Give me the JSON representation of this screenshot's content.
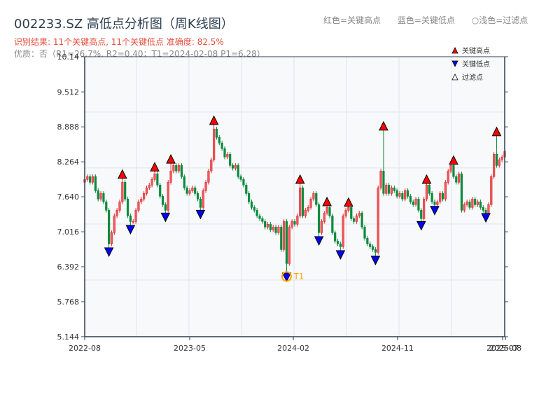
{
  "header": {
    "title": "002233.SZ 高低点分析图（周K线图）",
    "result": "识别结果: 11个关键高点, 11个关键低点  准确度: 82.5%",
    "quality": "优质：否（R1=26.7%, R2=0.40；T1=2024-02-08 P1=6.28）"
  },
  "top_legend": [
    "红色=关键高点",
    "蓝色=关键低点",
    "○浅色=过滤点"
  ],
  "colors": {
    "up": "#e02a2f",
    "down": "#0b8a3c",
    "key_high": "#ff0000",
    "key_low": "#0000ff",
    "t1": "#ffa500",
    "plot_bg": "#f7f9fb",
    "axis": "#2c3e50"
  },
  "chart_data": {
    "type": "candlestick",
    "title": "002233.SZ 高低点分析图（周K线图）",
    "ylim": [
      5.144,
      10.14
    ],
    "y_ticks": [
      "5.144",
      "5.768",
      "6.392",
      "7.016",
      "7.640",
      "8.264",
      "8.888",
      "9.512",
      "10.14"
    ],
    "x_ticks": [
      "2022-08",
      "2023-05",
      "2024-02",
      "2024-11",
      "2025-07",
      "2025-08"
    ],
    "grid": true,
    "legend_position": "top-right",
    "legend": [
      {
        "label": "关键高点",
        "marker": "triangle-up",
        "color": "#ff0000"
      },
      {
        "label": "关键低点",
        "marker": "triangle-down",
        "color": "#0000ff"
      },
      {
        "label": "过滤点",
        "marker": "triangle-up-hollow",
        "color": "#888888"
      }
    ],
    "close": [
      7.95,
      8.0,
      7.9,
      8.0,
      7.75,
      7.6,
      7.7,
      7.55,
      7.4,
      6.8,
      7.0,
      7.3,
      7.4,
      7.55,
      7.9,
      7.6,
      7.3,
      7.2,
      7.2,
      7.4,
      7.55,
      7.6,
      7.7,
      7.8,
      7.85,
      7.95,
      8.05,
      7.85,
      7.65,
      7.5,
      7.4,
      7.9,
      8.1,
      8.2,
      8.1,
      8.2,
      8.0,
      7.8,
      7.7,
      7.75,
      7.8,
      7.7,
      7.6,
      7.45,
      7.75,
      7.9,
      8.1,
      8.3,
      8.85,
      8.7,
      8.6,
      8.5,
      8.35,
      8.4,
      8.2,
      8.15,
      8.2,
      8.0,
      7.95,
      7.85,
      7.7,
      7.55,
      7.45,
      7.4,
      7.3,
      7.25,
      7.2,
      7.1,
      7.15,
      7.05,
      7.1,
      7.0,
      7.1,
      6.7,
      7.2,
      6.45,
      7.1,
      7.2,
      7.15,
      7.3,
      7.8,
      7.3,
      7.4,
      7.45,
      7.6,
      7.7,
      7.5,
      7.0,
      7.2,
      7.35,
      7.45,
      7.3,
      7.0,
      6.85,
      6.8,
      6.75,
      7.3,
      7.4,
      7.45,
      7.25,
      7.2,
      7.3,
      7.35,
      7.1,
      6.9,
      6.8,
      6.75,
      6.7,
      6.65,
      7.8,
      8.1,
      7.7,
      7.85,
      7.7,
      7.8,
      7.75,
      7.65,
      7.7,
      7.6,
      7.75,
      7.65,
      7.55,
      7.5,
      7.6,
      7.4,
      7.25,
      7.6,
      7.85,
      7.7,
      7.55,
      7.5,
      7.55,
      7.7,
      7.6,
      7.9,
      8.1,
      8.2,
      8.0,
      7.9,
      8.05,
      7.4,
      7.5,
      7.55,
      7.45,
      7.6,
      7.5,
      7.55,
      7.45,
      7.4,
      7.35,
      7.5,
      8.0,
      8.4,
      8.2,
      8.3,
      8.35,
      8.45
    ],
    "key_highs": [
      {
        "i": 14,
        "v": 7.97
      },
      {
        "i": 26,
        "v": 8.1
      },
      {
        "i": 32,
        "v": 8.24
      },
      {
        "i": 48,
        "v": 8.93
      },
      {
        "i": 80,
        "v": 7.88
      },
      {
        "i": 90,
        "v": 7.48
      },
      {
        "i": 98,
        "v": 7.47
      },
      {
        "i": 111,
        "v": 8.83
      },
      {
        "i": 127,
        "v": 7.88
      },
      {
        "i": 137,
        "v": 8.22
      },
      {
        "i": 153,
        "v": 8.73
      }
    ],
    "key_lows": [
      {
        "i": 9,
        "v": 6.73
      },
      {
        "i": 17,
        "v": 7.13
      },
      {
        "i": 30,
        "v": 7.35
      },
      {
        "i": 43,
        "v": 7.4
      },
      {
        "i": 75,
        "v": 6.28
      },
      {
        "i": 87,
        "v": 6.93
      },
      {
        "i": 95,
        "v": 6.68
      },
      {
        "i": 108,
        "v": 6.58
      },
      {
        "i": 125,
        "v": 7.2
      },
      {
        "i": 130,
        "v": 7.47
      },
      {
        "i": 149,
        "v": 7.34
      }
    ],
    "annotation": {
      "label": "T1",
      "i": 75,
      "v": 6.28
    }
  }
}
